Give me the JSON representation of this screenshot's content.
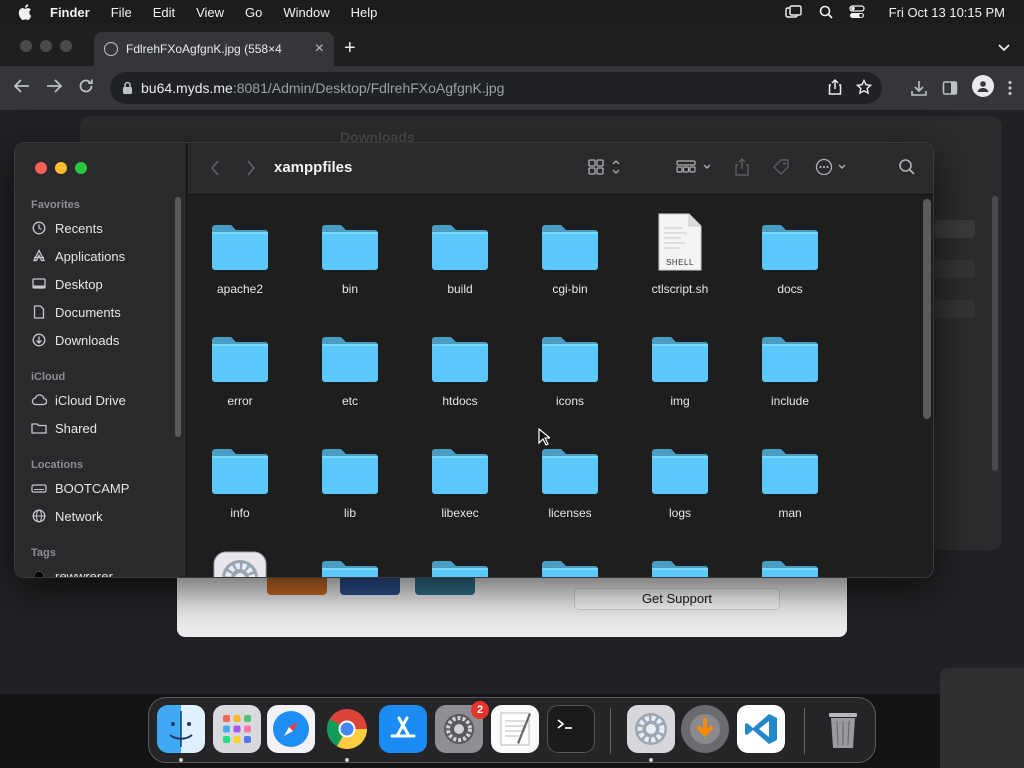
{
  "menubar": {
    "app_name": "Finder",
    "menus": [
      "File",
      "Edit",
      "View",
      "Go",
      "Window",
      "Help"
    ],
    "clock": "Fri Oct 13  10:15 PM",
    "status_icons": [
      "screen-mirroring-icon",
      "spotlight-search-icon",
      "control-center-icon"
    ]
  },
  "browser": {
    "tab_title": "FdlrehFXoAgfgnK.jpg (558×4",
    "url_host": "bu64.myds.me",
    "url_path": ":8081/Admin/Desktop/FdlrehFXoAgfgnK.jpg"
  },
  "background": {
    "finder_title": "Downloads",
    "xampp_button": "Get Support"
  },
  "finder": {
    "title": "xamppfiles",
    "sidebar": {
      "favorites_heading": "Favorites",
      "favorites": [
        {
          "label": "Recents",
          "icon": "clock-icon"
        },
        {
          "label": "Applications",
          "icon": "applications-icon"
        },
        {
          "label": "Desktop",
          "icon": "desktop-icon"
        },
        {
          "label": "Documents",
          "icon": "document-icon"
        },
        {
          "label": "Downloads",
          "icon": "download-icon"
        }
      ],
      "icloud_heading": "iCloud",
      "icloud": [
        {
          "label": "iCloud Drive",
          "icon": "cloud-icon"
        },
        {
          "label": "Shared",
          "icon": "shared-folder-icon"
        }
      ],
      "locations_heading": "Locations",
      "locations": [
        {
          "label": "BOOTCAMP",
          "icon": "drive-icon"
        },
        {
          "label": "Network",
          "icon": "network-icon"
        }
      ],
      "tags_heading": "Tags",
      "tags": [
        {
          "label": "rewwrerer",
          "color": "#000000"
        }
      ]
    },
    "items": [
      {
        "name": "apache2",
        "type": "folder"
      },
      {
        "name": "bin",
        "type": "folder"
      },
      {
        "name": "build",
        "type": "folder"
      },
      {
        "name": "cgi-bin",
        "type": "folder"
      },
      {
        "name": "ctlscript.sh",
        "type": "shell",
        "badge": "SHELL"
      },
      {
        "name": "docs",
        "type": "folder"
      },
      {
        "name": "error",
        "type": "folder"
      },
      {
        "name": "etc",
        "type": "folder"
      },
      {
        "name": "htdocs",
        "type": "folder"
      },
      {
        "name": "icons",
        "type": "folder"
      },
      {
        "name": "img",
        "type": "folder"
      },
      {
        "name": "include",
        "type": "folder"
      },
      {
        "name": "info",
        "type": "folder"
      },
      {
        "name": "lib",
        "type": "folder"
      },
      {
        "name": "libexec",
        "type": "folder"
      },
      {
        "name": "licenses",
        "type": "folder"
      },
      {
        "name": "logs",
        "type": "folder"
      },
      {
        "name": "man",
        "type": "folder"
      }
    ]
  },
  "dock": {
    "apps": [
      "Finder",
      "Launchpad",
      "Safari",
      "Google Chrome",
      "App Store",
      "System Settings",
      "TextEdit",
      "Terminal",
      "XAMPP Manager",
      "Downloads",
      "Visual Studio Code",
      "Trash"
    ],
    "settings_badge": "2"
  },
  "colors": {
    "folder": "#5ac8fa",
    "accent_red": "#ff5f57",
    "accent_yellow": "#febc2e",
    "accent_green": "#28c840"
  }
}
